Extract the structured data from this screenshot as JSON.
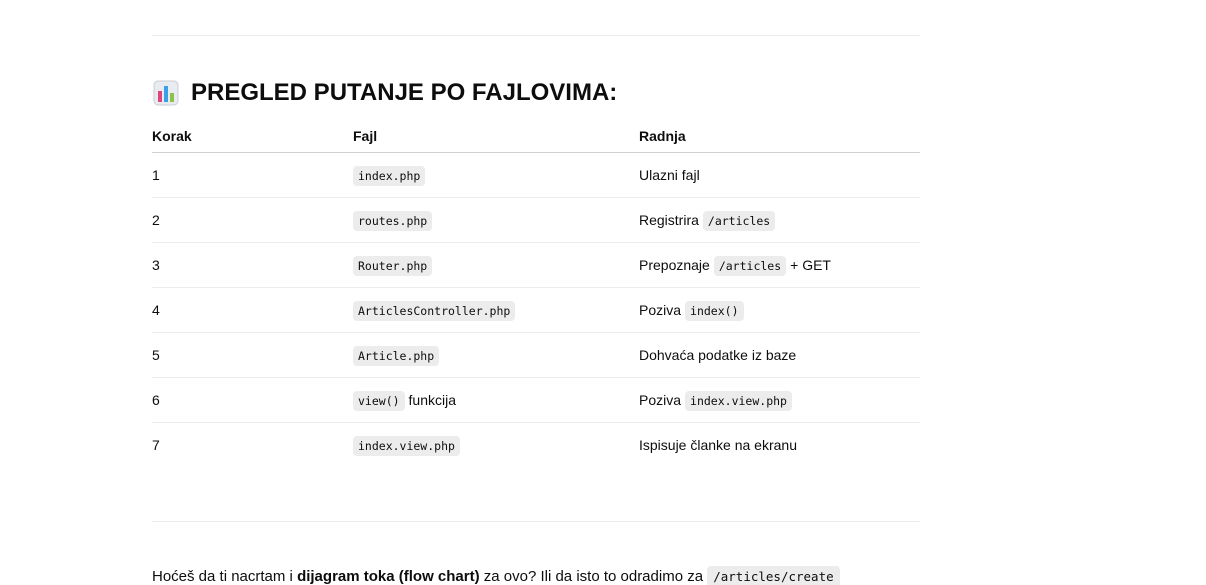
{
  "heading": {
    "icon": "bar-chart-emoji-icon",
    "text": "PREGLED PUTANJE PO FAJLOVIMA:"
  },
  "table": {
    "headers": [
      "Korak",
      "Fajl",
      "Radnja"
    ],
    "rows": [
      {
        "step": "1",
        "file": "index.php",
        "file_suffix": "",
        "action_pre": "Ulazni fajl",
        "action_code": "",
        "action_post": ""
      },
      {
        "step": "2",
        "file": "routes.php",
        "file_suffix": "",
        "action_pre": "Registrira",
        "action_code": "/articles",
        "action_post": ""
      },
      {
        "step": "3",
        "file": "Router.php",
        "file_suffix": "",
        "action_pre": "Prepoznaje",
        "action_code": "/articles",
        "action_post": "+ GET"
      },
      {
        "step": "4",
        "file": "ArticlesController.php",
        "file_suffix": "",
        "action_pre": "Poziva",
        "action_code": "index()",
        "action_post": ""
      },
      {
        "step": "5",
        "file": "Article.php",
        "file_suffix": "",
        "action_pre": "Dohvaća podatke iz baze",
        "action_code": "",
        "action_post": ""
      },
      {
        "step": "6",
        "file": "view()",
        "file_suffix": "funkcija",
        "action_pre": "Poziva",
        "action_code": "index.view.php",
        "action_post": ""
      },
      {
        "step": "7",
        "file": "index.view.php",
        "file_suffix": "",
        "action_pre": "Ispisuje članke na ekranu",
        "action_code": "",
        "action_post": ""
      }
    ]
  },
  "footer": {
    "text_1": "Hoćeš da ti nacrtam i ",
    "bold": "dijagram toka (flow chart)",
    "text_2": " za ovo? Ili da isto to odradimo za ",
    "code": "/articles/create"
  }
}
